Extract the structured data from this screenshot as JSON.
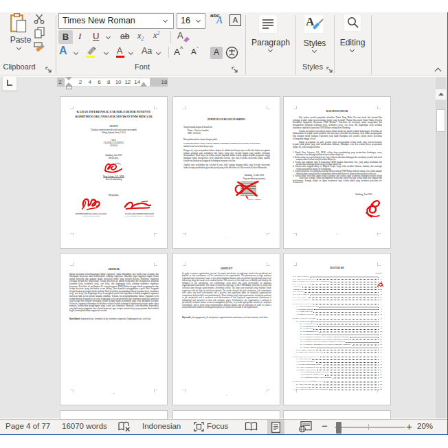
{
  "ribbon": {
    "paste_label": "Paste",
    "clipboard_group_label": "Clipboard",
    "font_name": "Times New Roman",
    "font_size": "16",
    "bold": "B",
    "italic": "I",
    "underline": "U",
    "strikethrough": "ab",
    "subscript_base": "x",
    "subscript_small": "2",
    "superscript_base": "x",
    "superscript_small": "2",
    "clear_format": "A",
    "text_effects": "A",
    "font_color": "A",
    "change_case": "Aa",
    "grow_font": "A",
    "shrink_font": "A",
    "char_shading": "A",
    "char_border": "A",
    "phonetic_abc": "abc",
    "phonetic_a": "A",
    "font_group_label": "Font",
    "paragraph_label": "Paragraph",
    "styles_label": "Styles",
    "styles_group_label": "Styles",
    "editing_label": "Editing"
  },
  "ruler": {
    "left_margin_num": "2",
    "numbers": [
      "2",
      "4",
      "6",
      "8",
      "10",
      "12",
      "14"
    ],
    "right_margin_num": "18",
    "tab_selector": "L"
  },
  "status": {
    "page": "Page 4 of 77",
    "words": "16070 words",
    "language": "Indonesian",
    "focus": "Focus",
    "zoom_out": "−",
    "zoom_in": "+",
    "zoom_level": "20%"
  },
  "pages": {
    "p1": {
      "title1": "KAJIAN INFERENSIAL FAKTOR-FAKTOR PENENTU",
      "title2": "KOMITMEN ORGANISASI KARYAWAN PNM MEKAAR",
      "doc_type": "SKRIPSI",
      "purpose1": "Diajukan untuk memenuhi salah satu syarat menempuh",
      "purpose2": "Sidang Sarjana Strata 1 (S-1)",
      "by_label": "Oleh",
      "author": "CHAVIRA ANANDITA",
      "nim": "0116124",
      "place_date": "Bandung, Juni 2020",
      "approve": "Menyetujui,",
      "advisor_name": "Nany Ariyani, S.E., M.M.",
      "advisor_role": "Dosen Pembimbing",
      "know": "Mengetahui,",
      "dean_name": "Tan Ming Kuang, S.E., M.Si., Ak., Ph.D.",
      "dean_role": "Dekan Fakultas Bisnis",
      "head_name": "Dr. Drs. Adjie Nugraha Wijaya, M.M.",
      "head_role": "Ketua Program Studi S-1 Manajemen"
    },
    "p2": {
      "heading": "PERNYATAAN KEASLIAN SKRIPSI",
      "line1": "Yang bertanda tangan di bawah ini:",
      "line2": "Nama : Chavira Anandita",
      "line3": "NRP : 0116124",
      "line4": "Menyatakan bahwa skripsi dengan judul:",
      "judul": "Kajian Inferensial Faktor-Faktor Penentu Komitmen Organisasi Karyawan PNM Mekaar",
      "line5": "adalah benar-benar hasil karya saya.",
      "paragraphs": [
        "Dengan ini, saya menyatakan bahwa skripsi ini adalah hasil karya saya sendiri dan bukan merupakan salinan sebagian atau seluruhnya dari karya orang lain, kecuali bagian yang sumber informasi dicantumkan. Hasil karya ini belum pernah diajukan dalam bentuk apapun kepada perguruan tinggi manapun untuk memperoleh gelar akademik tertentu, dan saya bersedia menerima sanksi apabila terbukti melakukan pelanggaran terhadap pernyataan tersebut.",
        "Apabila saya melakukan hal tersebut di atas, baik sengaja maupun tidak, saya bersedia menerima sanksi berupa pembatalan gelar dan ijazah yang telah diberikan oleh Universitas Kristen Maranatha."
      ],
      "date_line": "Bandung, 15 Juni 2020",
      "sign_label": "Yang membuat pernyataan,",
      "sign_name": "Chavira Anandita",
      "page_num": "1"
    },
    "p3": {
      "heading": "KATA PENGANTAR",
      "paragraphs": [
        "Puji syukur penulis panjatkan kehadirat Tuhan Yang Maha Esa atas kasih dan karunia-Nya sehingga penulis dapat menyelesaikan skripsi yang berjudul \"Kajian Inferensial Faktor-Faktor Penentu Komitmen Organisasi Karyawan PNM Mekaar\". Penelitian ini bertujuan untuk mengetahui dan menganalisis pengaruh kepuasan kerja, komitmen kerja, etos kerja dan lingkungan kerja terhadap komitmen organisasi karyawan PNM Mekaar cabang Kota Bandung.",
        "Penulis menyadari sepenuhnya bahwa dalam skripsi ini masih terdapat kekurangan. Penelitian ini dilaksanakan di tengah situasi pandemi dan karenanya memiliki keterbatasan, baik dalam pengumpulan data maupun dalam cakupan responden yang dapat dijangkau oleh penulis selama proses penelitian berlangsung hingga selesai.",
        "Dalam kesempatan ini pula, penulis ingin mengucapkan terima kasih yang sebesar-besarnya kepada pihak-pihak yang telah memberikan bantuan, dukungan serta doa selama proses penyusunan skripsi ini, yaitu sebagai berikut:"
      ],
      "list": [
        "1. Bapak Dany Setiawan, S.E., M.M., selaku dosen pembimbing yang memberikan bimbingan, saran, masukan, serta dukungan dalam menyelesaikan skripsi ini.",
        "2. Kedua orang tua serta keluarga besar yang selalu memberikan dukungan dan membantu penulis baik moril maupun materil dalam menyelesaikan skripsi ini.",
        "3. Teman satu angkatan baik di konsentrasi SDM maupun konsentrasi lain, yang saling membantu dan memberikan semangat dalam menyelesaikan skripsi ini.",
        "4. Teman-teman anggota Barep of Magical People yang selalu memberi hiburan, bantuan, dan semangat selama penyusunan skripsi ini berlangsung.",
        "5. Pegawai koperasi serta pimpinan masing-masing cabang PNM Mekaar baik di cabang Asia Afrika maupun cabang lainnya yang bersedia berpartisipasi dan memberikan izin dalam pelaksanaan penelitian ini.",
        "6. Semua pihak yang tidak dapat penulis sebutkan satu persatu yang senantiasa membantu penulis dalam penyusunan penelitian ini."
      ],
      "closing": "Akhir kata, semoga Tuhan melimpahkan berkat dan kasih-Nya bagi semua pihak atas bantuan dan kebaikannya. Semoga skripsi ini dapat bermanfaat bagi seluruh pihak yang membaca penelitian ini. Terimakasih.",
      "date_line": "Bandung, Juni 2020",
      "page_num": "iii"
    },
    "p4": {
      "heading": "ABSTRAK",
      "body": "Dalam menjamin keberlangsungan hidup organisasi, maka dibutuhkan niat untuk tetap bertahan dan diharapkan karyawan akan berkontribusi terhadap organisasi. Diketahui juga tingginya tingkat keluar masuk karyawan dan gagasan dalam mengelola faktor yang menjadi penentu komitmen organisasi sehingga menjadi hal yang krusial. Tujuan penelitian ini adalah mengetahui dan menganalisis pengaruh kepuasan kerja, komitmen kerja, etos kerja, dan lingkungan kerja terhadap komitmen organisasi karyawan. Penelitian ini melibatkan 85 orang karyawan PNM Mekaar dengan teknik pengumpulan data berupa kuesioner yang disebarkan secara daring. Data dianalisis menggunakan regresi linier berganda dengan bantuan perangkat lunak statistik. Hasil penelitian menunjukkan bahwa kepuasan kerja, komitmen kerja, etos kerja, dan lingkungan kerja berpengaruh positif dan signifikan terhadap komitmen organisasi karyawan baik secara parsial maupun simultan. Temuan ini mengimplikasikan bahwa organisasi perlu memperhatikan kepuasan kerja serta lingkungan kerja yang kondusif agar komitmen organisasi karyawan tetap terjaga dan semakin meningkat sejalan dengan tujuan perusahaan yang telah ditetapkan bersama. Selain itu, organisasi disarankan melakukan evaluasi berkala terhadap kebijakan pengelolaan sumber daya manusia, memberikan penghargaan yang sesuai atas kontribusi karyawan, serta membina komunikasi yang baik antara pimpinan dan seluruh karyawan agar tercipta suasana kerja yang nyaman dan kondusif bagi seluruh pihak dalam organisasi tersebut.",
      "keywords_label": "Kata Kunci:",
      "keywords": " kepuasan kerja, komitmen kerja, komitmen organisasi, lingkungan kerja, etos kerja",
      "page_num": "iv"
    },
    "p5": {
      "heading": "ABSTRACT",
      "body": "In order to ensure organization survival, the needs and desires of employees need to be considered and fulfilled so that continuance will be committed to the organization. The phenomenon of high employee organizational commitment issues is also acknowledged elements that can fall having high employees to an interesting thing that needs to be studied further. The concern of this study was to identify and analyze the influence of job satisfaction, job commitment, work ethos and work environment on employee organizational commitment. This study involved 85 employees of the PNM Mekaar branches in which and collected data through questionnaires distributed online. The data were analyzed using multiple linear regression with the help of statistical software. The results showed that job satisfaction, job commitment, work ethos and work environment had a positive and significant effect on employee organizational commitment both partially and simultaneously. These findings imply that organizations should pay attention to job satisfaction and a conducive work environment so that employee organizational commitment is maintained and increases in line with company goals. Furthermore, the organization is advised to periodically evaluate human resource management policies, to provide appropriate rewards for employee contribution, and to foster good communication between leaders and all employees in order to create a comfortable and conducive working atmosphere for all parties involved in the organization.",
      "keywords_label": "Keywords:",
      "keywords": " job engagement, job satisfaction, organizational commitment, work environment, work ethos",
      "page_num": "v"
    },
    "p6": {
      "heading": "DAFTAR ISI",
      "col_header": "Halaman",
      "rows": [
        {
          "t": "HALAMAN JUDUL",
          "p": "i",
          "ind": 0
        },
        {
          "t": "HALAMAN PENGESAHAN",
          "p": "ii",
          "ind": 0
        },
        {
          "t": "SURAT PERNYATAAN KEASLIAN SKRIPSI",
          "p": "iii",
          "ind": 0
        },
        {
          "t": "KATA PENGANTAR",
          "p": "iv",
          "ind": 0
        },
        {
          "t": "ABSTRAK",
          "p": "vii",
          "ind": 0
        },
        {
          "t": "ABSTRACT",
          "p": "viii",
          "ind": 0,
          "b": 1
        },
        {
          "t": "DAFTAR ISI",
          "p": "ix",
          "ind": 0
        },
        {
          "t": "DAFTAR GAMBAR",
          "p": "xii",
          "ind": 0
        },
        {
          "t": "DAFTAR TABEL",
          "p": "xiii",
          "ind": 0
        },
        {
          "t": "DAFTAR LAMPIRAN",
          "p": "xvi",
          "ind": 0
        },
        {
          "t": "BAB I PENDAHULUAN",
          "p": "1",
          "ind": 0,
          "gap": 5
        },
        {
          "t": "1.1 Latar Belakang Penelitian",
          "p": "1",
          "ind": 10
        },
        {
          "t": "1.2 Rumusan Masalah",
          "p": "9",
          "ind": 10
        },
        {
          "t": "1.3 Tujuan Penelitian",
          "p": "9",
          "ind": 10
        },
        {
          "t": "1.4 Manfaat Penelitian",
          "p": "10",
          "ind": 10
        },
        {
          "t": "BAB II LANDASAN TEORI",
          "p": "11",
          "ind": 0,
          "gap": 5
        },
        {
          "t": "2.1 Kajian Pustaka",
          "p": "11",
          "ind": 10
        },
        {
          "t": "2.1.1 Kepuasan Kerja",
          "p": "11",
          "ind": 22
        },
        {
          "t": "2.1.2 Komitmen Kerja",
          "p": "16",
          "ind": 22
        },
        {
          "t": "2.1.3 Etos Kerja",
          "p": "19",
          "ind": 22
        },
        {
          "t": "2.1.4 Lingkungan Kerja",
          "p": "20",
          "ind": 22
        },
        {
          "t": "2.1.5 Komitmen Organisasi",
          "p": "23",
          "ind": 22
        },
        {
          "t": "2.1.6 Pengaruh Kepuasan Kerja terhadap Komitmen Organisasi",
          "p": "26",
          "ind": 22
        },
        {
          "t": "2.1.7 Pengaruh Komitmen Kerja terhadap Komitmen Organisasi",
          "p": "27",
          "ind": 22
        },
        {
          "t": "2.1.8 Pengaruh Etos Kerja terhadap Komitmen Organisasi",
          "p": "28",
          "ind": 22
        },
        {
          "t": "2.1.9 Pengaruh Lingkungan Kerja terhadap Komitmen Organisasi",
          "p": "29",
          "ind": 22
        },
        {
          "t": "2.1.10 Riset Empiris",
          "p": "30",
          "ind": 22
        },
        {
          "t": "2.2 Kerangka Pemikiran",
          "p": "33",
          "ind": 10
        },
        {
          "t": "2.3 Model dan Hipotesis Penelitian",
          "p": "35",
          "ind": 10
        },
        {
          "t": "BAB III METODE PENELITIAN",
          "p": "37",
          "ind": 0,
          "gap": 5
        },
        {
          "t": "3.1 Jenis Penelitian",
          "p": "37",
          "ind": 10
        },
        {
          "t": "3.2 Populasi dan Sampel",
          "p": "38",
          "ind": 10
        },
        {
          "t": "3.3 Definisi Operasional Variabel",
          "p": "39",
          "ind": 10
        },
        {
          "t": "3.4 Teknik Pengumpulan Data",
          "p": "42",
          "ind": 10
        },
        {
          "t": "3.5 Metode Analisis Data",
          "p": "43",
          "ind": 10
        },
        {
          "t": "3.5.1 Pengujian Instrumen Penelitian",
          "p": "43",
          "ind": 22
        },
        {
          "t": "3.5.2 Pengujian Asumsi Klasik",
          "p": "45",
          "ind": 22
        },
        {
          "t": "3.5.3 Pengujian Regresi Linier Berganda",
          "p": "47",
          "ind": 22
        },
        {
          "t": "BAB IV HASIL DAN PEMBAHASAN",
          "p": "49",
          "ind": 0,
          "gap": 5
        },
        {
          "t": "4.1 Hasil Penelitian",
          "p": "49",
          "ind": 10
        },
        {
          "t": "4.2 Pembahasan",
          "p": "58",
          "ind": 10
        },
        {
          "t": "4.3 Pengujian Hipotesis Dan Pembahasan",
          "p": "62",
          "ind": 10
        }
      ]
    }
  }
}
